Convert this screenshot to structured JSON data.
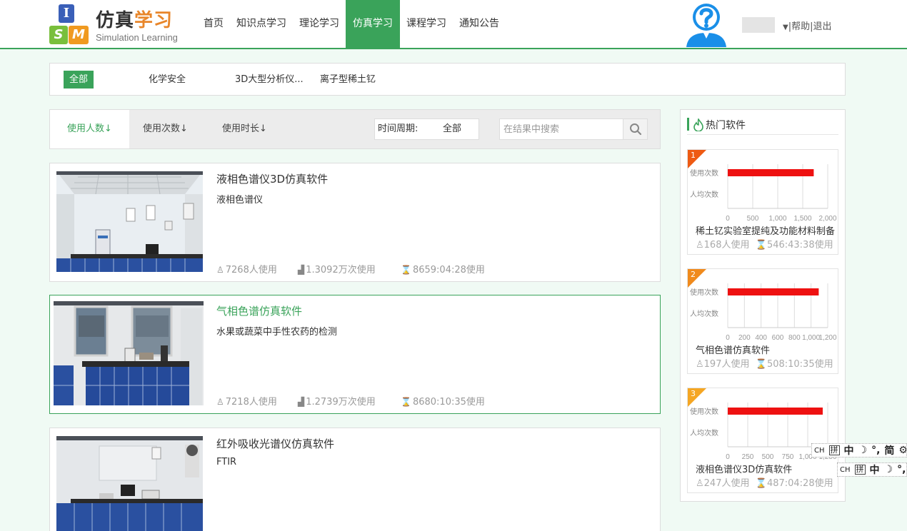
{
  "header": {
    "logo_char_i": "I",
    "logo_char_s": "S",
    "logo_char_m": "M",
    "logo_title_a": "仿真",
    "logo_title_b": "学习",
    "logo_subtitle": "Simulation Learning",
    "nav": [
      "首页",
      "知识点学习",
      "理论学习",
      "仿真学习",
      "课程学习",
      "通知公告"
    ],
    "active_nav": "仿真学习",
    "help": "帮助",
    "logout": "退出",
    "dropdown_icon": "caret-down-icon",
    "avatar_icon": "question-avatar-icon"
  },
  "categories": {
    "items": [
      "全部",
      "化学安全",
      "3D大型分析仪...",
      "离子型稀土钇"
    ],
    "active": "全部"
  },
  "sortbar": {
    "tabs": [
      "使用人数",
      "使用次数",
      "使用时长"
    ],
    "arrow": "↓",
    "active": "使用人数",
    "period_label": "时间周期:",
    "period_value": "全部",
    "search_placeholder": "在结果中搜索",
    "search_icon": "search-icon"
  },
  "software_list": [
    {
      "title": "液相色谱仪3D仿真软件",
      "subtitle": "液相色谱仪",
      "users": "7268人使用",
      "uses": "1.3092万次使用",
      "duration": "8659:04:28使用",
      "selected": false
    },
    {
      "title": "气相色谱仿真软件",
      "subtitle": "水果或蔬菜中手性农药的检测",
      "users": "7218人使用",
      "uses": "1.2739万次使用",
      "duration": "8680:10:35使用",
      "selected": true
    },
    {
      "title": "红外吸收光谱仪仿真软件",
      "subtitle": "FTIR",
      "users": "",
      "uses": "",
      "duration": "",
      "selected": false
    }
  ],
  "hot": {
    "title": "热门软件",
    "icon": "flame-icon",
    "items": [
      {
        "rank": "1",
        "rank_color": "#ee5a13",
        "name": "稀土钇实验室提纯及功能材料制备",
        "users": "168人使用",
        "duration": "546:43:38使用",
        "row_labels": [
          "使用次数",
          "人均次数"
        ],
        "ticks": [
          "0",
          "500",
          "1,000",
          "1,500",
          "2,000"
        ],
        "value_fraction": 0.86
      },
      {
        "rank": "2",
        "rank_color": "#f08a1c",
        "name": "气相色谱仿真软件",
        "users": "197人使用",
        "duration": "508:10:35使用",
        "row_labels": [
          "使用次数",
          "人均次数"
        ],
        "ticks": [
          "0",
          "200",
          "400",
          "600",
          "800",
          "1,000",
          "1,200"
        ],
        "value_fraction": 0.91
      },
      {
        "rank": "3",
        "rank_color": "#f5a623",
        "name": "液相色谱仪3D仿真软件",
        "users": "247人使用",
        "duration": "487:04:28使用",
        "row_labels": [
          "使用次数",
          "人均次数"
        ],
        "ticks": [
          "0",
          "250",
          "500",
          "750",
          "1,000",
          "1,250"
        ],
        "value_fraction": 0.95
      }
    ]
  },
  "ime": {
    "ch": "CH",
    "pin": "拼",
    "zh": "中",
    "moon": "☽",
    "punct": "°,",
    "jian": "简",
    "gear": "⚙"
  }
}
